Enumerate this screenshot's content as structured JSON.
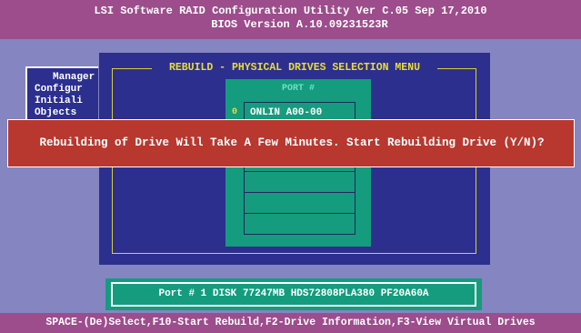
{
  "title_bar": {
    "line1": "LSI Software RAID Configuration Utility Ver C.05 Sep 17,2010",
    "line2": "BIOS Version  A.10.09231523R"
  },
  "background_menu": {
    "items": [
      "Manager",
      "Configur",
      "Initiali",
      "Objects"
    ]
  },
  "rebuild_menu": {
    "title": "REBUILD - PHYSICAL DRIVES SELECTION MENU",
    "port_header": "PORT #",
    "slots": [
      {
        "index": "0",
        "label": "ONLIN A00-00"
      },
      {
        "index": "",
        "label": ""
      },
      {
        "index": "",
        "label": ""
      },
      {
        "index": "",
        "label": ""
      },
      {
        "index": "",
        "label": ""
      },
      {
        "index": "",
        "label": ""
      }
    ]
  },
  "dialog": {
    "message": "Rebuilding of Drive Will Take A Few Minutes. Start Rebuilding Drive (Y/N)?"
  },
  "status": {
    "text": "Port # 1 DISK  77247MB  HDS72808PLA380  PF20A60A"
  },
  "help_bar": {
    "text": "SPACE-(De)Select,F10-Start Rebuild,F2-Drive Information,F3-View Virtual Drives"
  },
  "colors": {
    "background": "#8585c2",
    "title_bar": "#9d4d8c",
    "panel": "#2d2f8f",
    "port_box": "#159c7e",
    "dialog": "#b8372f",
    "accent_text": "#e8dc3c"
  }
}
